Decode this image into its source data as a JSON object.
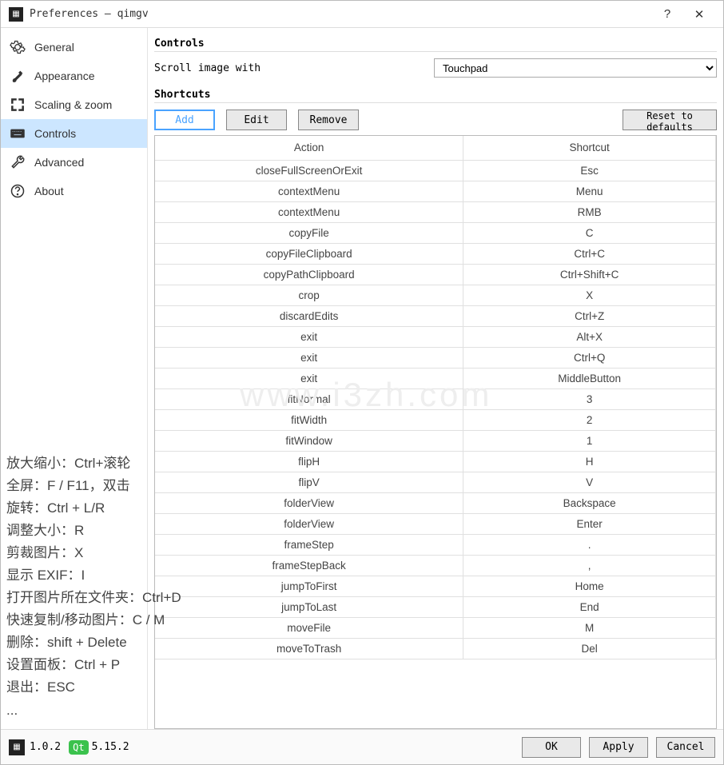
{
  "window": {
    "title": "Preferences — qimgv",
    "help": "?",
    "close": "✕"
  },
  "sidebar": {
    "items": [
      {
        "key": "general",
        "label": "General"
      },
      {
        "key": "appearance",
        "label": "Appearance"
      },
      {
        "key": "scaling",
        "label": "Scaling & zoom"
      },
      {
        "key": "controls",
        "label": "Controls"
      },
      {
        "key": "advanced",
        "label": "Advanced"
      },
      {
        "key": "about",
        "label": "About"
      }
    ],
    "active": "controls"
  },
  "content": {
    "section_controls": "Controls",
    "scroll_label": "Scroll image with",
    "scroll_value": "Touchpad",
    "section_shortcuts": "Shortcuts",
    "buttons": {
      "add": "Add",
      "edit": "Edit",
      "remove": "Remove",
      "reset": "Reset to defaults"
    },
    "table": {
      "headers": [
        "Action",
        "Shortcut"
      ],
      "rows": [
        [
          "closeFullScreenOrExit",
          "Esc"
        ],
        [
          "contextMenu",
          "Menu"
        ],
        [
          "contextMenu",
          "RMB"
        ],
        [
          "copyFile",
          "C"
        ],
        [
          "copyFileClipboard",
          "Ctrl+C"
        ],
        [
          "copyPathClipboard",
          "Ctrl+Shift+C"
        ],
        [
          "crop",
          "X"
        ],
        [
          "discardEdits",
          "Ctrl+Z"
        ],
        [
          "exit",
          "Alt+X"
        ],
        [
          "exit",
          "Ctrl+Q"
        ],
        [
          "exit",
          "MiddleButton"
        ],
        [
          "fitNormal",
          "3"
        ],
        [
          "fitWidth",
          "2"
        ],
        [
          "fitWindow",
          "1"
        ],
        [
          "flipH",
          "H"
        ],
        [
          "flipV",
          "V"
        ],
        [
          "folderView",
          "Backspace"
        ],
        [
          "folderView",
          "Enter"
        ],
        [
          "frameStep",
          "."
        ],
        [
          "frameStepBack",
          ","
        ],
        [
          "jumpToFirst",
          "Home"
        ],
        [
          "jumpToLast",
          "End"
        ],
        [
          "moveFile",
          "M"
        ],
        [
          "moveToTrash",
          "Del"
        ]
      ]
    }
  },
  "footer": {
    "version": "1.0.2",
    "qt_label": "Qt",
    "qt_version": "5.15.2",
    "ok": "OK",
    "apply": "Apply",
    "cancel": "Cancel"
  },
  "overlay_lines": [
    "放大缩小：Ctrl+滚轮",
    "全屏：F / F11，双击",
    "旋转：Ctrl + L/R",
    "调整大小：R",
    "剪裁图片：X",
    "显示 EXIF：I",
    "打开图片所在文件夹：Ctrl+D",
    "快速复制/移动图片：C / M",
    "删除：shift + Delete",
    "设置面板：Ctrl + P",
    "退出：ESC",
    "..."
  ],
  "watermark": "www.i3zh.com"
}
